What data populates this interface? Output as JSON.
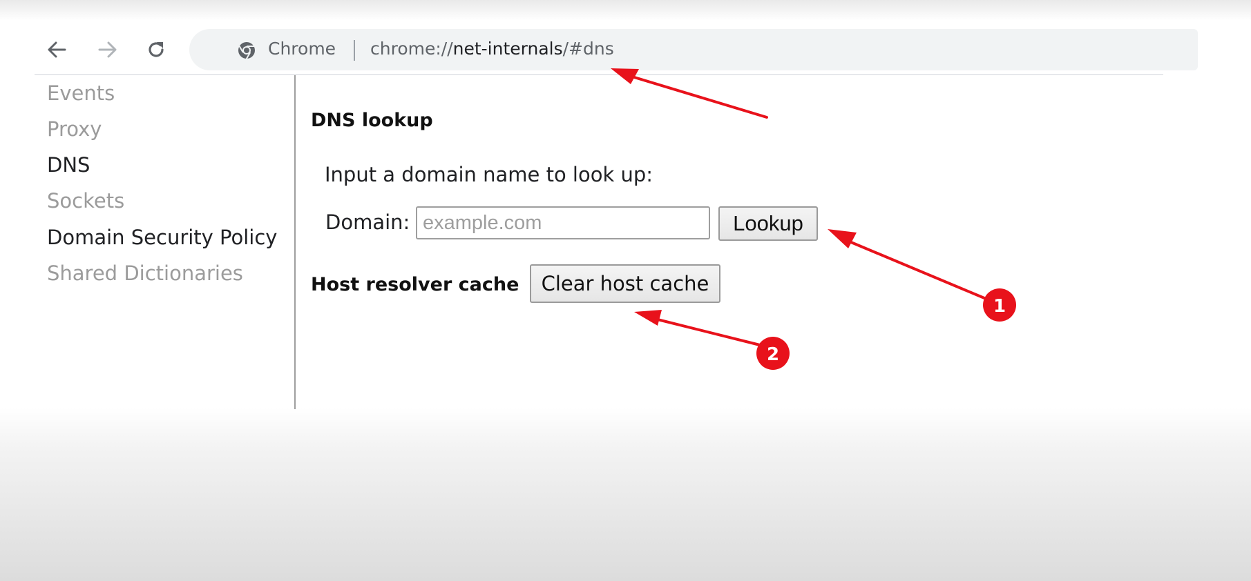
{
  "toolbar": {
    "back_icon": "arrow-left-icon",
    "forward_icon": "arrow-right-icon",
    "reload_icon": "reload-icon",
    "omnibox": {
      "site_icon": "chrome-logo-icon",
      "site_label": "Chrome",
      "url_scheme": "chrome://",
      "url_host": "net-internals",
      "url_path": "/#dns"
    }
  },
  "sidebar": {
    "items": [
      {
        "label": "Events",
        "active": false
      },
      {
        "label": "Proxy",
        "active": false
      },
      {
        "label": "DNS",
        "active": true
      },
      {
        "label": "Sockets",
        "active": false
      },
      {
        "label": "Domain Security Policy",
        "active": true
      },
      {
        "label": "Shared Dictionaries",
        "active": false
      }
    ]
  },
  "main": {
    "dns_lookup": {
      "title": "DNS lookup",
      "instruction": "Input a domain name to look up:",
      "domain_label": "Domain:",
      "domain_value": "",
      "domain_placeholder": "example.com",
      "lookup_button": "Lookup"
    },
    "host_resolver": {
      "title": "Host resolver cache",
      "clear_button": "Clear host cache"
    }
  },
  "annotations": {
    "color": "#e8121b",
    "markers": [
      "1",
      "2"
    ]
  }
}
